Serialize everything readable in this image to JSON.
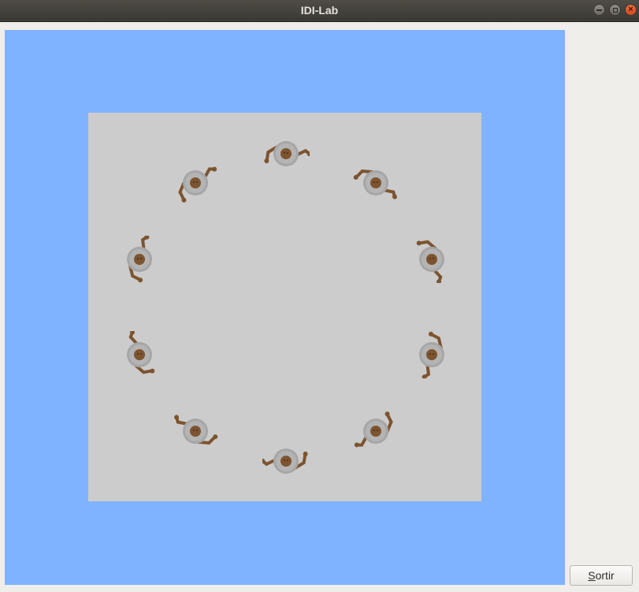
{
  "window": {
    "title": "IDI-Lab"
  },
  "controls": {
    "exit_label": "Sortir",
    "exit_mnemonic": "S"
  },
  "scene": {
    "background_color": "#80b3ff",
    "floor_color": "#cccccc",
    "figure_count": 10,
    "figures": [
      {
        "id": 1,
        "facing_deg": 0
      },
      {
        "id": 2,
        "facing_deg": 36
      },
      {
        "id": 3,
        "facing_deg": 72
      },
      {
        "id": 4,
        "facing_deg": 108
      },
      {
        "id": 5,
        "facing_deg": 144
      },
      {
        "id": 6,
        "facing_deg": 180
      },
      {
        "id": 7,
        "facing_deg": 216
      },
      {
        "id": 8,
        "facing_deg": 252
      },
      {
        "id": 9,
        "facing_deg": 288
      },
      {
        "id": 10,
        "facing_deg": 324
      }
    ]
  }
}
